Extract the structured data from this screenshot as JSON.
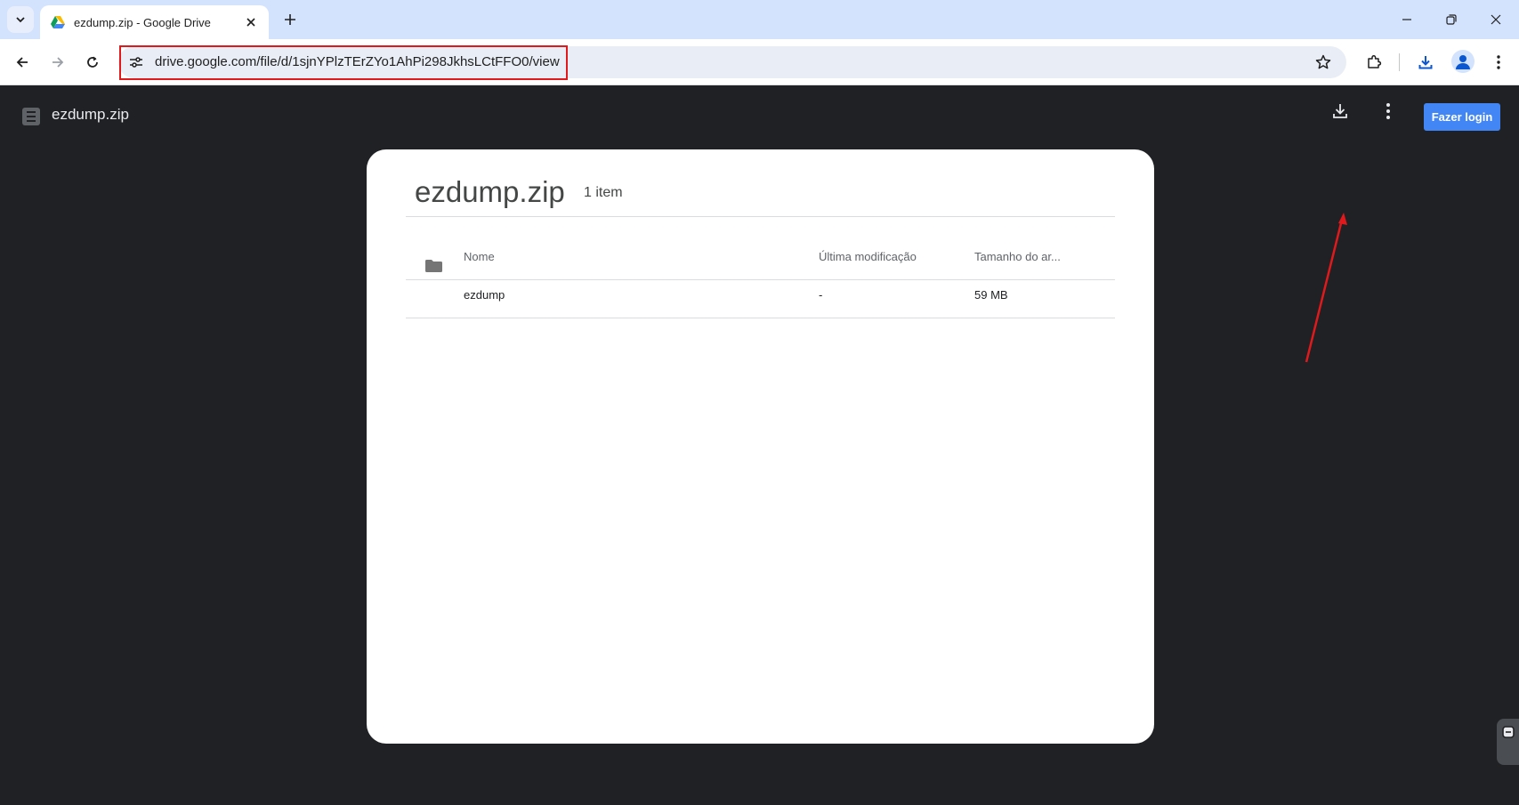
{
  "browser": {
    "tab_title": "ezdump.zip - Google Drive",
    "url": "drive.google.com/file/d/1sjnYPlzTErZYo1AhPi298JkhsLCtFFO0/view",
    "icons": {
      "tab_search": "chevron-down-icon",
      "favicon": "google-drive-icon",
      "close_tab": "close-icon",
      "new_tab": "plus-icon",
      "back": "arrow-left-icon",
      "forward": "arrow-right-icon",
      "reload": "reload-icon",
      "site_info": "tune-icon",
      "bookmark": "star-icon",
      "extensions": "puzzle-icon",
      "downloads": "download-icon",
      "profile": "person-icon",
      "menu": "more-vertical-icon"
    }
  },
  "viewer": {
    "file_name": "ezdump.zip",
    "login_label": "Fazer login",
    "accent_color": "#4285f4",
    "annotation_color": "#e0191d"
  },
  "archive": {
    "title": "ezdump.zip",
    "count": "1 item",
    "columns": {
      "name": "Nome",
      "modified": "Última modificação",
      "size": "Tamanho do ar..."
    },
    "rows": [
      {
        "name": "ezdump",
        "modified": "-",
        "size": "59 MB",
        "type": "folder"
      }
    ]
  }
}
